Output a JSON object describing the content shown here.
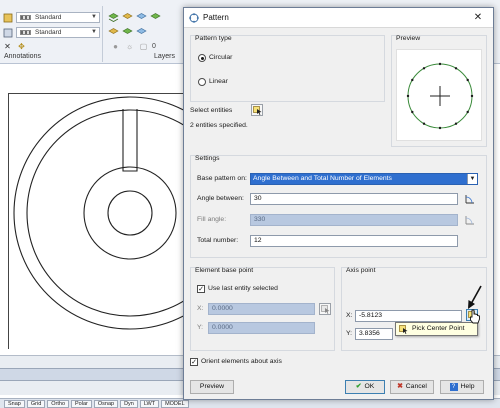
{
  "background_app": {
    "ribbon": {
      "linetype_combo_1": "Standard",
      "linetype_combo_2": "Standard",
      "layer_count": "0",
      "panels": [
        "Annotations",
        "Layers"
      ]
    },
    "status_bar": {
      "buttons": [
        "Snap",
        "Grid",
        "Ortho",
        "Polar",
        "Osnap",
        "Dyn",
        "LWT",
        "MODEL"
      ],
      "coordinates": ""
    }
  },
  "dialog": {
    "title": "Pattern",
    "pattern_type": {
      "label": "Pattern type",
      "options": [
        "Circular",
        "Linear"
      ],
      "selected": "Circular"
    },
    "preview": {
      "label": "Preview"
    },
    "select_entities": {
      "label": "Select entities",
      "status": "2 entities specified."
    },
    "settings": {
      "label": "Settings",
      "base_pattern_label": "Base pattern on:",
      "base_pattern_value": "Angle Between and Total Number of Elements",
      "angle_between_label": "Angle between:",
      "angle_between_value": "30",
      "fill_angle_label": "Fill angle:",
      "fill_angle_value": "330",
      "total_number_label": "Total number:",
      "total_number_value": "12"
    },
    "element_base_point": {
      "label": "Element base point",
      "use_last_entity_label": "Use last entity selected",
      "use_last_entity_checked": true,
      "x_label": "X:",
      "x_value": "0.0000",
      "y_label": "Y:",
      "y_value": "0.0000"
    },
    "axis_point": {
      "label": "Axis point",
      "x_label": "X:",
      "x_value": "-5.8123",
      "y_label": "Y:",
      "y_value": "3.8356"
    },
    "orient_elements": {
      "label": "Orient elements about axis",
      "checked": true
    },
    "buttons": {
      "preview": "Preview",
      "ok": "OK",
      "cancel": "Cancel",
      "help": "Help"
    },
    "tooltip": "Pick Center Point"
  },
  "colors": {
    "accent": "#2f6fcf",
    "disabled_field": "#b8c8e0",
    "ok_check": "#2e9e2e",
    "cancel_x": "#c0392b",
    "preview_arc": "#3a8a3a"
  }
}
